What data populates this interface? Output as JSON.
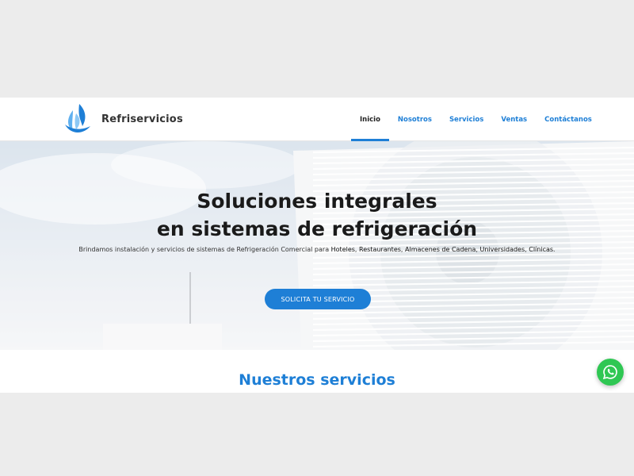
{
  "header": {
    "brand": "Refriservicios",
    "nav": [
      "Inicio",
      "Nosotros",
      "Servicios",
      "Ventas",
      "Contáctanos"
    ],
    "active_index": 0
  },
  "hero": {
    "title_line1": "Soluciones integrales",
    "title_line2": "en sistemas de refrigeración",
    "subtitle_prefix": "Brindamos instalación y servicios de sistemas de Refrigeración Comercial para ",
    "subtitle_items": [
      "Hoteles",
      "Restaurantes",
      "Almacenes de Cadena",
      "Universidades",
      "Clínicas"
    ],
    "cta_label": "SOLICITA TU SERVICIO"
  },
  "services": {
    "title": "Nuestros servicios"
  },
  "colors": {
    "accent": "#1e7fd6",
    "whatsapp": "#2fc753"
  },
  "icons": {
    "logo": "snowflake-flame-logo",
    "whatsapp": "whatsapp-icon"
  }
}
